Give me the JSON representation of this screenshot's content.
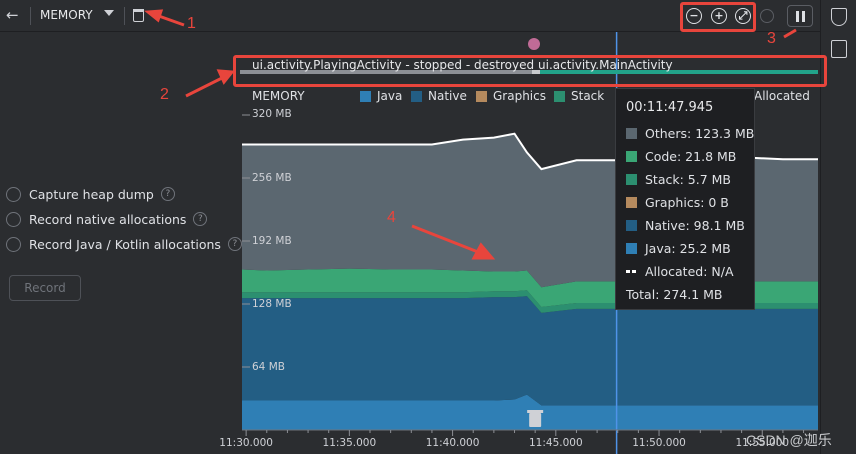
{
  "toolbar": {
    "profiler_select": "MEMORY",
    "zoom_out_label": "−",
    "zoom_in_label": "+",
    "reset_zoom_label": "⤢"
  },
  "options": {
    "items": [
      {
        "label": "Capture heap dump"
      },
      {
        "label": "Record native allocations"
      },
      {
        "label": "Record Java / Kotlin allocations"
      }
    ],
    "record_button": "Record",
    "help_glyph": "?"
  },
  "activities": [
    {
      "label": "ui.activity.PlayingActivity - stopped - destroyed",
      "color": "#8c8f95"
    },
    {
      "label": "ui.activity.MainActivity",
      "color": "#22a38a"
    }
  ],
  "legend": {
    "title": "MEMORY",
    "items": [
      {
        "label": "Java",
        "color": "#2f7fb5"
      },
      {
        "label": "Native",
        "color": "#235e84"
      },
      {
        "label": "Graphics",
        "color": "#b58a5e"
      },
      {
        "label": "Stack",
        "color": "#2c8f70"
      }
    ],
    "allocated_label": "Allocated"
  },
  "tooltip": {
    "time": "00:11:47.945",
    "rows": [
      {
        "label": "Others: 123.3 MB",
        "color": "#5b6770"
      },
      {
        "label": "Code: 21.8 MB",
        "color": "#3aa675"
      },
      {
        "label": "Stack: 5.7 MB",
        "color": "#2c8f70"
      },
      {
        "label": "Graphics: 0 B",
        "color": "#b58a5e"
      },
      {
        "label": "Native: 98.1 MB",
        "color": "#235e84"
      },
      {
        "label": "Java: 25.2 MB",
        "color": "#2f7fb5"
      },
      {
        "label": "Allocated: N/A",
        "color": "#ffffff",
        "dashed": true
      },
      {
        "label": "Total: 274.1 MB",
        "color": ""
      }
    ]
  },
  "annotations": {
    "n1": "1",
    "n2": "2",
    "n3": "3",
    "n4": "4"
  },
  "watermark": "CSDN @迦乐",
  "chart_data": {
    "type": "area",
    "title": "MEMORY",
    "y_ticks": [
      "320 MB",
      "256 MB",
      "192 MB",
      "128 MB",
      "64 MB"
    ],
    "y_tick_values": [
      320,
      256,
      192,
      128,
      64
    ],
    "ylim": [
      0,
      320
    ],
    "x_ticks": [
      "11:30.000",
      "11:35.000",
      "11:40.000",
      "11:45.000",
      "11:50.000",
      "11:55.000"
    ],
    "x_tick_seconds": [
      690,
      695,
      700,
      705,
      710,
      715
    ],
    "xlim_seconds": [
      689.8,
      717.7
    ],
    "cursor_seconds": 707.945,
    "gc_event_seconds": 704.0,
    "x_seconds": [
      689.8,
      691,
      693,
      695,
      697,
      699,
      700.5,
      702,
      703,
      703.6,
      704.3,
      706,
      708,
      710,
      712,
      714,
      716,
      717.7
    ],
    "series": [
      {
        "name": "Java",
        "color": "#2f7fb5",
        "values": [
          30,
          30,
          30,
          30,
          30,
          30,
          30,
          30,
          31,
          36,
          25,
          25,
          25,
          25,
          25,
          25,
          25,
          25
        ]
      },
      {
        "name": "Native",
        "color": "#235e84",
        "values": [
          104,
          104,
          104,
          104,
          104,
          104,
          104,
          105,
          104,
          100,
          94,
          98,
          98,
          98,
          98,
          98,
          98,
          98
        ]
      },
      {
        "name": "Stack",
        "color": "#2c8f70",
        "values": [
          6,
          6,
          6,
          6,
          6,
          6,
          6,
          6,
          6,
          6,
          6,
          6,
          6,
          6,
          6,
          6,
          6,
          6
        ]
      },
      {
        "name": "Code",
        "color": "#3aa675",
        "values": [
          23,
          22,
          23,
          24,
          23,
          23,
          22,
          20,
          20,
          20,
          20,
          22,
          22,
          22,
          22,
          22,
          22,
          22
        ]
      },
      {
        "name": "Others",
        "color": "#5b6770",
        "values": [
          127,
          128,
          127,
          126,
          127,
          127,
          133,
          136,
          140,
          120,
          120,
          123,
          123,
          123,
          124,
          126,
          124,
          124
        ]
      }
    ],
    "total_line_color": "#ffffff"
  }
}
